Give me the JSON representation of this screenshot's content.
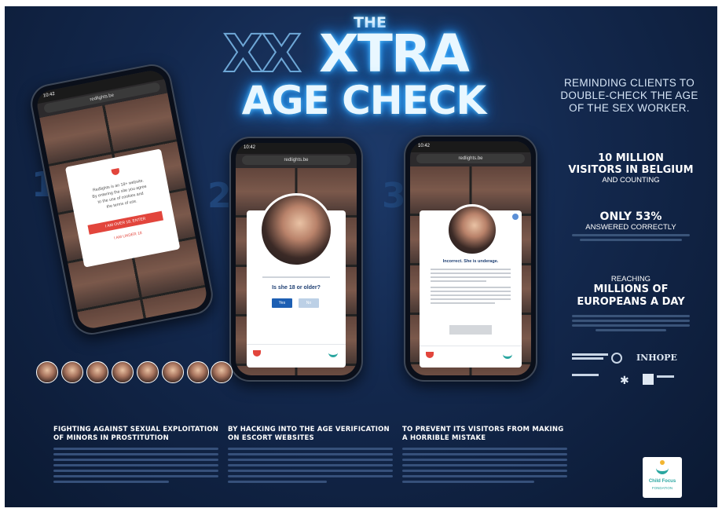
{
  "title": {
    "the": "THE",
    "xx": "XX",
    "tra": "XTRA",
    "age_check": "AGE CHECK"
  },
  "tagline": "REMINDING CLIENTS TO DOUBLE-CHECK THE AGE OF THE SEX WORKER.",
  "stats": [
    {
      "big": "10 MILLION\nVISITORS IN BELGIUM",
      "small": "AND COUNTING"
    },
    {
      "big": "ONLY 53%",
      "small": "ANSWERED CORRECTLY"
    },
    {
      "pre": "REACHING",
      "big": "MILLIONS OF\nEUROPEANS A DAY"
    }
  ],
  "step_numbers": [
    "1",
    "2",
    "3"
  ],
  "phone1": {
    "url": "redlights.be",
    "time": "10:42",
    "modal_lines": [
      "Redlights is an 18+ website.",
      "By entering the site you agree",
      "to the use of cookies and",
      "the terms of use."
    ],
    "enter_button": "I AM OVER 18, ENTER",
    "leave_link": "I AM UNDER 18"
  },
  "phone2": {
    "url": "redlights.be",
    "time": "10:42",
    "question": "Is she 18 or older?",
    "yes": "Yes",
    "no": "No"
  },
  "phone3": {
    "url": "redlights.be",
    "time": "10:42",
    "headline": "Incorrect. She is underage."
  },
  "columns": [
    {
      "heading": "FIGHTING AGAINST SEXUAL EXPLOITATION\nOF MINORS IN PROSTITUTION"
    },
    {
      "heading": "BY HACKING INTO THE AGE VERIFICATION\nON ESCORT WEBSITES"
    },
    {
      "heading": "TO PREVENT ITS VISITORS FROM MAKING\nA HORRIBLE MISTAKE"
    }
  ],
  "partner_logos": [
    "INHOPE"
  ],
  "brand_logo": {
    "line1": "Child Focus",
    "line2": "FONDATION"
  },
  "colors": {
    "background": "#13284d",
    "neon": "#59c3ff",
    "red_button": "#e2453c",
    "blue_button": "#1d5fb3"
  }
}
